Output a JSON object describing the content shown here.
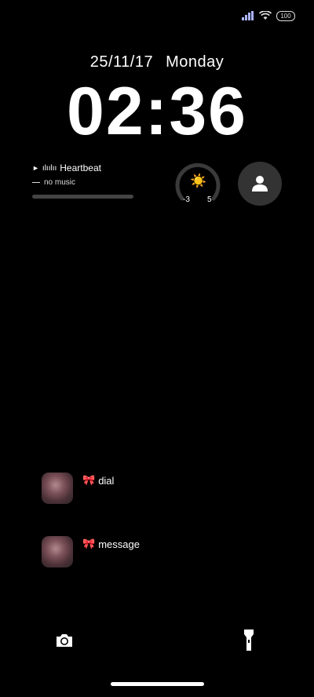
{
  "status": {
    "battery": "100"
  },
  "lockscreen": {
    "date": "25/11/17",
    "weekday": "Monday",
    "time": "02:36"
  },
  "music": {
    "play_glyph": "►",
    "wave_glyph": "ılıılıı",
    "title": "Heartbeat",
    "dash_glyph": "⎯⎯",
    "subtitle": "no music",
    "progress": 0
  },
  "weather": {
    "icon": "sun-icon",
    "low": "-3",
    "high": "5"
  },
  "shortcuts": [
    {
      "emoji": "🎀",
      "label": "dial"
    },
    {
      "emoji": "🎀",
      "label": "message"
    }
  ],
  "colors": {
    "background": "#000000",
    "bow": "#e8333f",
    "weather_ring": "#3a3a3a",
    "contact_bg": "#333333"
  }
}
